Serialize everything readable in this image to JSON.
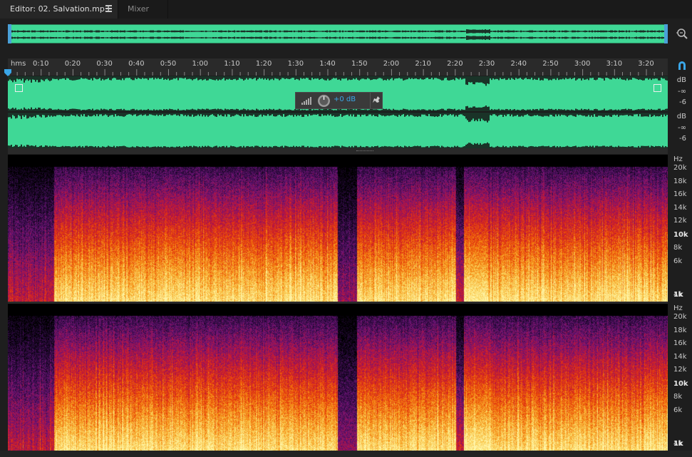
{
  "tabs": {
    "editor_label": "Editor: 02. Salvation.mp3",
    "mixer_label": "Mixer"
  },
  "ruler": {
    "unit_label": "hms",
    "ticks": [
      "0:10",
      "0:20",
      "0:30",
      "0:40",
      "0:50",
      "1:00",
      "1:10",
      "1:20",
      "1:30",
      "1:40",
      "1:50",
      "2:00",
      "2:10",
      "2:20",
      "2:30",
      "2:40",
      "2:50",
      "3:00",
      "3:10",
      "3:20"
    ]
  },
  "hud": {
    "gain": "+0 dB"
  },
  "db_scale": {
    "left": [
      "dB",
      "-∞",
      "-6"
    ],
    "right": [
      "dB",
      "-∞",
      "-6"
    ]
  },
  "hz_scale": {
    "left": [
      "Hz",
      "20k",
      "18k",
      "16k",
      "14k",
      "12k",
      "10k",
      "8k",
      "6k",
      "4k",
      "1k"
    ],
    "right": [
      "Hz",
      "20k",
      "18k",
      "16k",
      "14k",
      "12k",
      "10k",
      "8k",
      "6k",
      "4k",
      "1k"
    ]
  },
  "icons": {
    "tab_menu": "hamburger-icon",
    "zoom": "zoom-icon",
    "snap": "magnet-icon",
    "gain": "knob-icon",
    "pin": "pin-icon"
  },
  "colors": {
    "waveform": "#3fd896",
    "accent": "#3aa6e8",
    "background": "#1e1e1e"
  }
}
